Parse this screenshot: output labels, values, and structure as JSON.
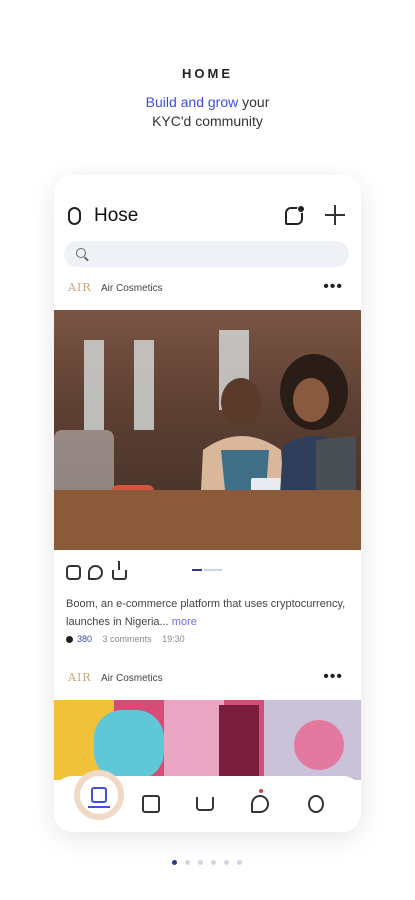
{
  "hero": {
    "title": "HOME",
    "subtitle_accent": "Build and grow",
    "subtitle_rest": " your",
    "subtitle_line2": "KYC'd community"
  },
  "app": {
    "name": "Hose",
    "search": {
      "placeholder": "",
      "value": ""
    }
  },
  "posts": [
    {
      "brand_logo": "AIR",
      "brand_name": "Air Cosmetics",
      "caption": "Boom, an e-commerce platform that uses cryptocurrency, launches in Nigeria...",
      "more": " more",
      "likes": "380",
      "comments": "3 comments",
      "time": "19:30"
    },
    {
      "brand_logo": "AIR",
      "brand_name": "Air Cosmetics"
    }
  ],
  "nav": {
    "items": [
      "feed-icon",
      "wallet-icon",
      "cart-icon",
      "notification-icon",
      "profile-icon"
    ],
    "active": 0
  },
  "pager": {
    "count": 6,
    "current": 0
  },
  "colors": {
    "accent": "#3d4fdc",
    "link": "#6a6fd6"
  }
}
